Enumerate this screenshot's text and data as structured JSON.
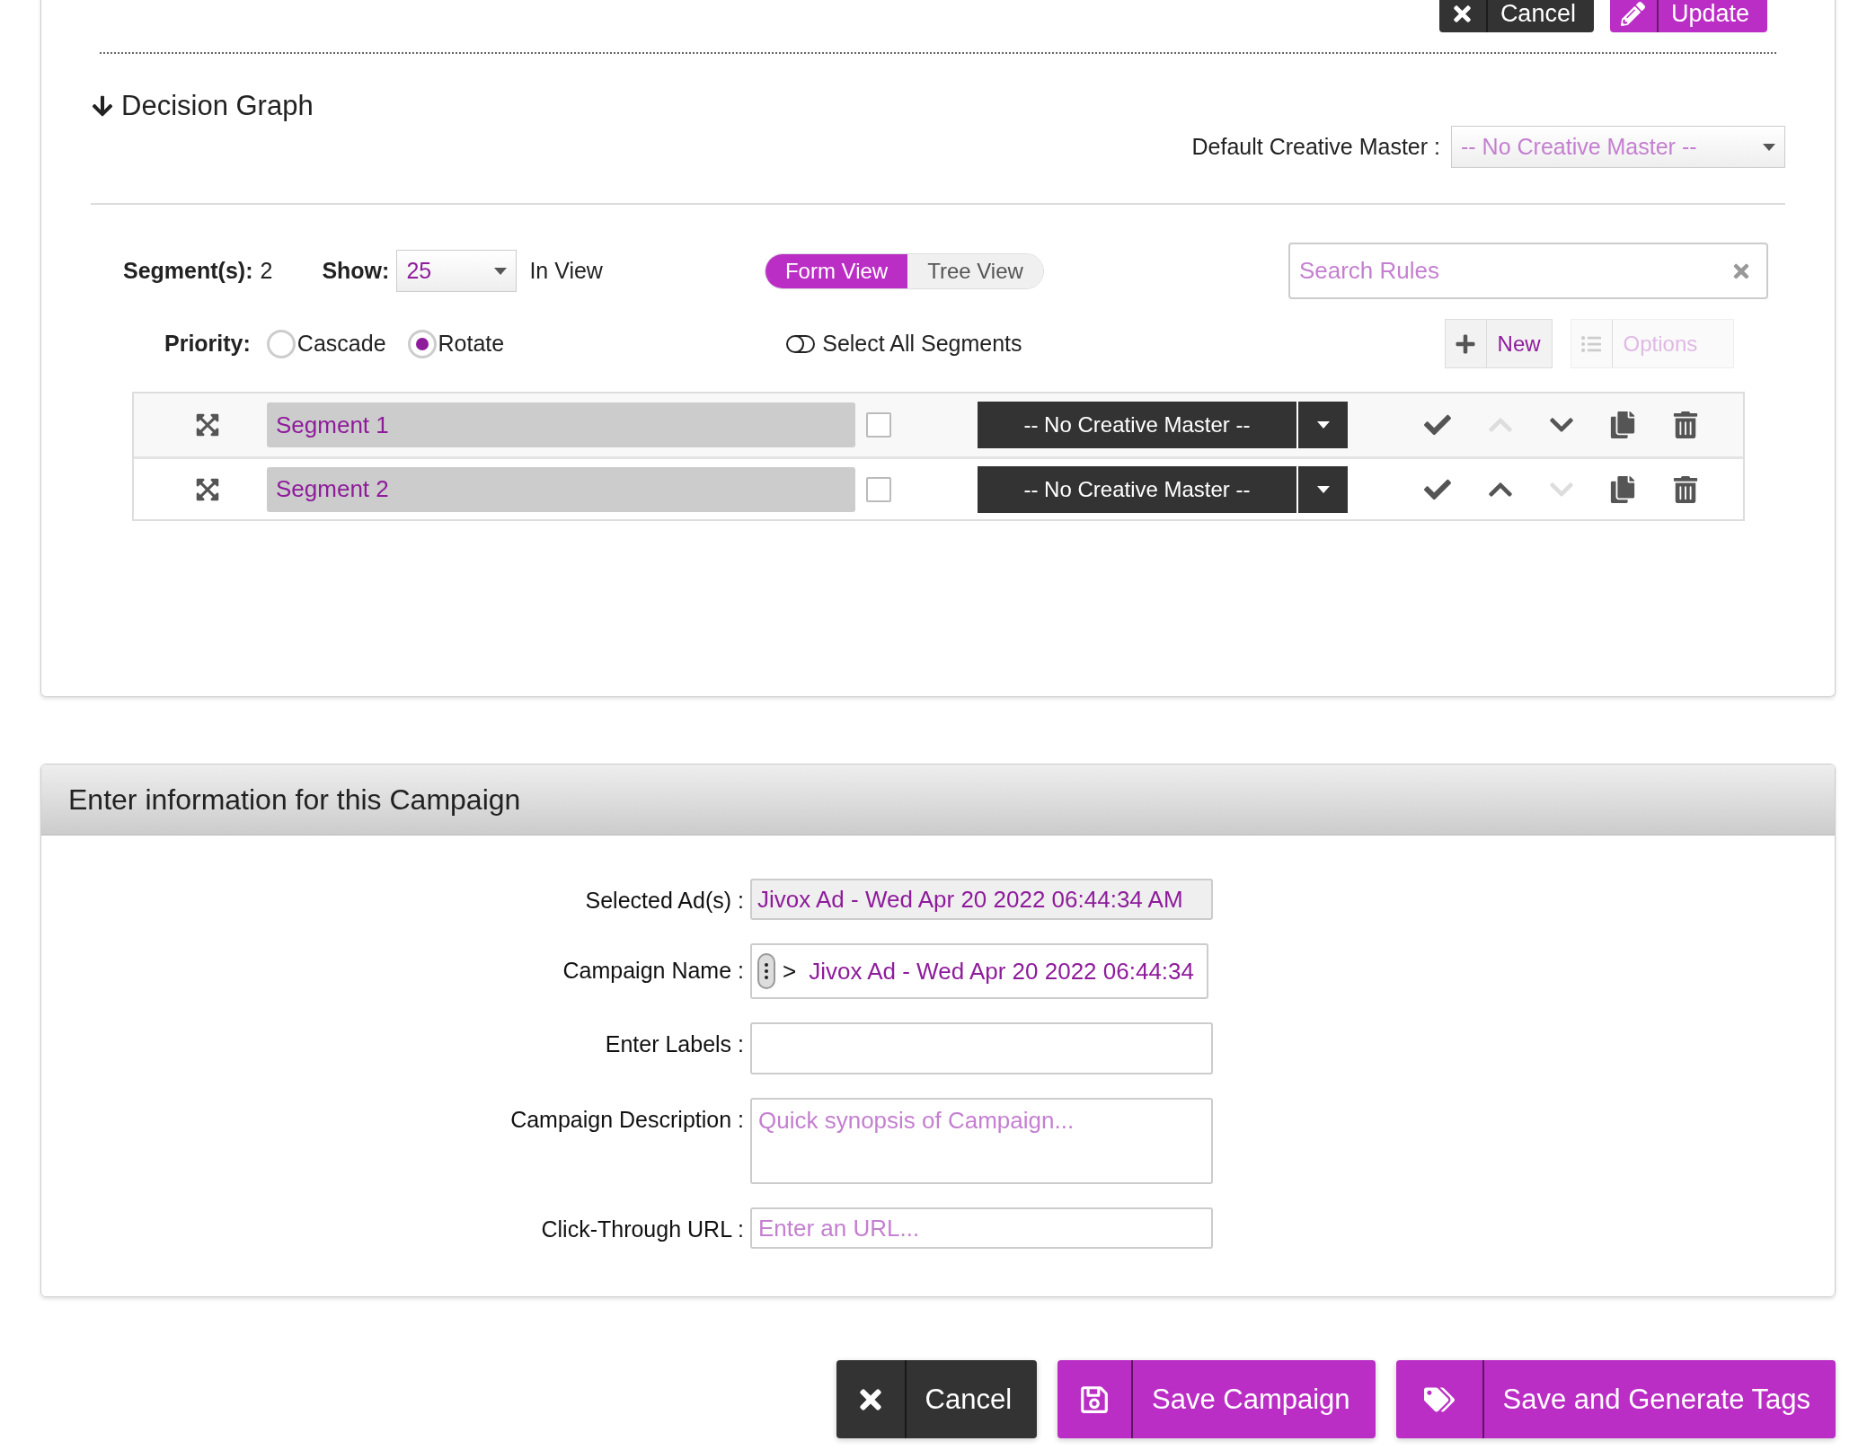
{
  "header_actions": [
    {
      "kind": "cancel",
      "label": "Cancel"
    },
    {
      "kind": "update",
      "label": "Update"
    }
  ],
  "decision_graph": {
    "title": "Decision Graph",
    "default_creative_master": {
      "label": "Default Creative Master :",
      "value": "-- No Creative Master --"
    },
    "segments_count": {
      "label": "Segment(s):",
      "value": "2"
    },
    "show": {
      "label": "Show:",
      "value": "25",
      "suffix": "In View"
    },
    "views": [
      {
        "label": "Form View",
        "selected": true
      },
      {
        "label": "Tree View",
        "selected": false
      }
    ],
    "search": {
      "placeholder": "Search Rules"
    },
    "priority": {
      "label": "Priority:",
      "options": [
        {
          "label": "Cascade",
          "selected": false
        },
        {
          "label": "Rotate",
          "selected": true
        }
      ]
    },
    "select_all": {
      "label": "Select All Segments",
      "on": false
    },
    "new_button": {
      "label": "New"
    },
    "options_button": {
      "label": "Options",
      "disabled": true
    },
    "segments": [
      {
        "name": "Segment 1",
        "checked": false,
        "creative_master": "-- No Creative Master --",
        "move_up_disabled": true,
        "move_down_disabled": false
      },
      {
        "name": "Segment 2",
        "checked": false,
        "creative_master": "-- No Creative Master --",
        "move_up_disabled": false,
        "move_down_disabled": true
      }
    ]
  },
  "campaign_form": {
    "title": "Enter information for this Campaign",
    "fields": [
      {
        "kind": "readonly",
        "label": "Selected Ad(s) :",
        "value": "Jivox Ad - Wed Apr 20 2022 06:44:34 AM"
      },
      {
        "kind": "name",
        "label": "Campaign Name :",
        "prefix": ">",
        "value": "Jivox Ad - Wed Apr 20 2022 06:44:34"
      },
      {
        "kind": "text",
        "label": "Enter Labels :"
      },
      {
        "kind": "textarea",
        "label": "Campaign Description :",
        "placeholder": "Quick synopsis of Campaign..."
      },
      {
        "kind": "text",
        "label": "Click-Through URL :",
        "placeholder": "Enter an URL..."
      }
    ]
  },
  "footer_buttons": [
    {
      "kind": "cancel",
      "label": "Cancel"
    },
    {
      "kind": "save",
      "label": "Save Campaign"
    },
    {
      "kind": "tags",
      "label": "Save and Generate Tags"
    }
  ]
}
